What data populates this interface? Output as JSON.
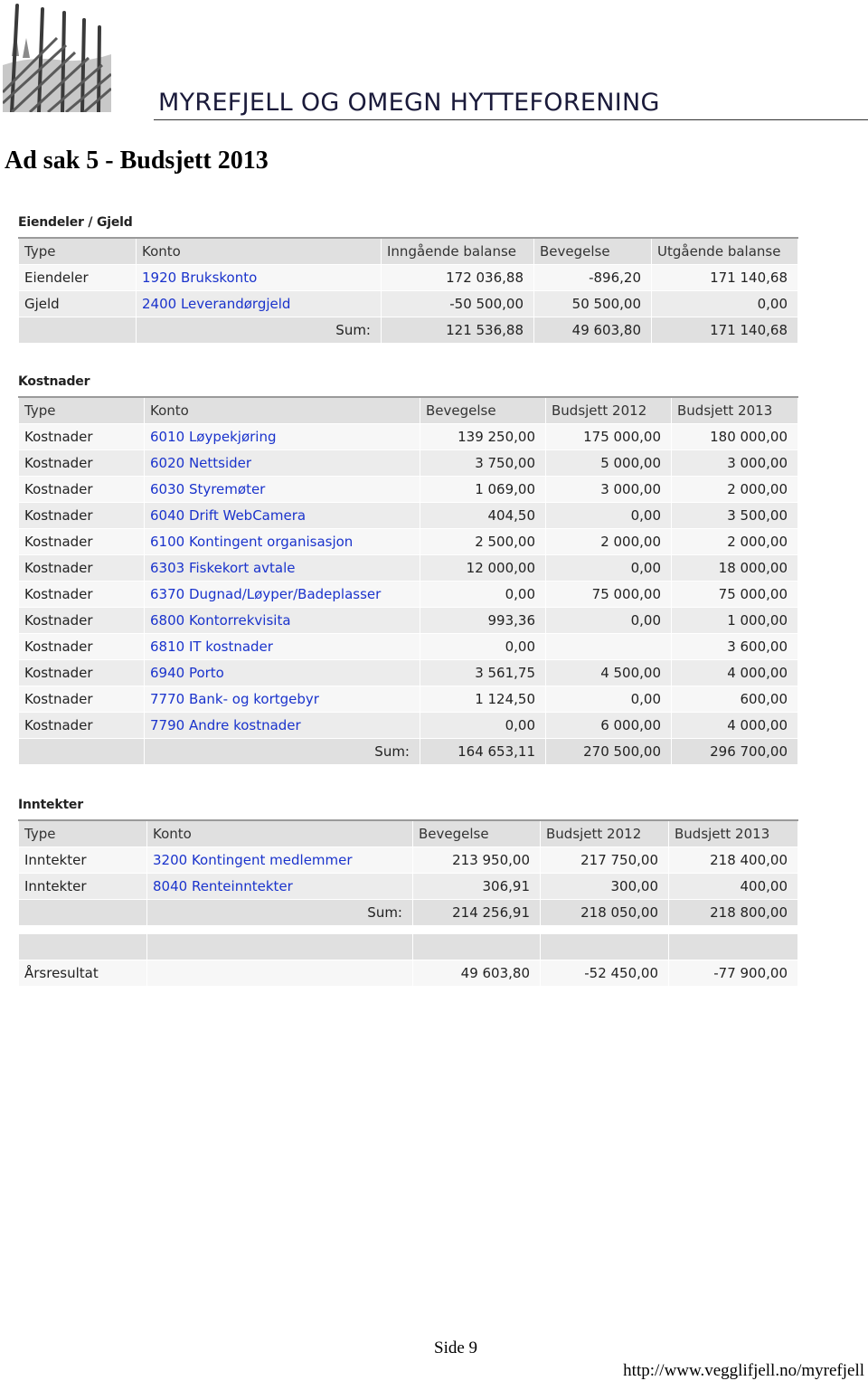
{
  "header": {
    "org_name": "MYREFJELL OG OMEGN HYTTEFORENING"
  },
  "page_title": "Ad sak 5 - Budsjett 2013",
  "assets": {
    "heading": "Eiendeler / Gjeld",
    "columns": [
      "Type",
      "Konto",
      "Inngående balanse",
      "Bevegelse",
      "Utgående balanse"
    ],
    "rows": [
      {
        "type": "Eiendeler",
        "konto": "1920 Brukskonto",
        "inngaende": "172 036,88",
        "bevegelse": "-896,20",
        "utgaende": "171 140,68"
      },
      {
        "type": "Gjeld",
        "konto": "2400 Leverandørgjeld",
        "inngaende": "-50 500,00",
        "bevegelse": "50 500,00",
        "utgaende": "0,00"
      }
    ],
    "sum": {
      "label": "Sum:",
      "inngaende": "121 536,88",
      "bevegelse": "49 603,80",
      "utgaende": "171 140,68"
    }
  },
  "costs": {
    "heading": "Kostnader",
    "columns": [
      "Type",
      "Konto",
      "Bevegelse",
      "Budsjett 2012",
      "Budsjett 2013"
    ],
    "rows": [
      {
        "type": "Kostnader",
        "konto": "6010 Løypekjøring",
        "bevegelse": "139 250,00",
        "b2012": "175 000,00",
        "b2013": "180 000,00"
      },
      {
        "type": "Kostnader",
        "konto": "6020 Nettsider",
        "bevegelse": "3 750,00",
        "b2012": "5 000,00",
        "b2013": "3 000,00"
      },
      {
        "type": "Kostnader",
        "konto": "6030 Styremøter",
        "bevegelse": "1 069,00",
        "b2012": "3 000,00",
        "b2013": "2 000,00"
      },
      {
        "type": "Kostnader",
        "konto": "6040 Drift WebCamera",
        "bevegelse": "404,50",
        "b2012": "0,00",
        "b2013": "3 500,00"
      },
      {
        "type": "Kostnader",
        "konto": "6100 Kontingent organisasjon",
        "bevegelse": "2 500,00",
        "b2012": "2 000,00",
        "b2013": "2 000,00"
      },
      {
        "type": "Kostnader",
        "konto": "6303 Fiskekort avtale",
        "bevegelse": "12 000,00",
        "b2012": "0,00",
        "b2013": "18 000,00"
      },
      {
        "type": "Kostnader",
        "konto": "6370 Dugnad/Løyper/Badeplasser",
        "bevegelse": "0,00",
        "b2012": "75 000,00",
        "b2013": "75 000,00"
      },
      {
        "type": "Kostnader",
        "konto": "6800 Kontorrekvisita",
        "bevegelse": "993,36",
        "b2012": "0,00",
        "b2013": "1 000,00"
      },
      {
        "type": "Kostnader",
        "konto": "6810 IT kostnader",
        "bevegelse": "0,00",
        "b2012": "",
        "b2013": "3 600,00"
      },
      {
        "type": "Kostnader",
        "konto": "6940 Porto",
        "bevegelse": "3 561,75",
        "b2012": "4 500,00",
        "b2013": "4 000,00"
      },
      {
        "type": "Kostnader",
        "konto": "7770 Bank- og kortgebyr",
        "bevegelse": "1 124,50",
        "b2012": "0,00",
        "b2013": "600,00"
      },
      {
        "type": "Kostnader",
        "konto": "7790 Andre kostnader",
        "bevegelse": "0,00",
        "b2012": "6 000,00",
        "b2013": "4 000,00"
      }
    ],
    "sum": {
      "label": "Sum:",
      "bevegelse": "164 653,11",
      "b2012": "270 500,00",
      "b2013": "296 700,00"
    }
  },
  "income": {
    "heading": "Inntekter",
    "columns": [
      "Type",
      "Konto",
      "Bevegelse",
      "Budsjett 2012",
      "Budsjett 2013"
    ],
    "rows": [
      {
        "type": "Inntekter",
        "konto": "3200 Kontingent medlemmer",
        "bevegelse": "213 950,00",
        "b2012": "217 750,00",
        "b2013": "218 400,00"
      },
      {
        "type": "Inntekter",
        "konto": "8040 Renteinntekter",
        "bevegelse": "306,91",
        "b2012": "300,00",
        "b2013": "400,00"
      }
    ],
    "sum": {
      "label": "Sum:",
      "bevegelse": "214 256,91",
      "b2012": "218 050,00",
      "b2013": "218 800,00"
    },
    "result": {
      "label": "Årsresultat",
      "bevegelse": "49 603,80",
      "b2012": "-52 450,00",
      "b2013": "-77 900,00"
    }
  },
  "footer": {
    "page": "Side 9",
    "url": "http://www.vegglifjell.no/myrefjell"
  },
  "colors": {
    "link": "#1a33cc",
    "header_row": "#e0e0e0",
    "row_light": "#f7f7f7",
    "row_dark": "#ececec"
  }
}
